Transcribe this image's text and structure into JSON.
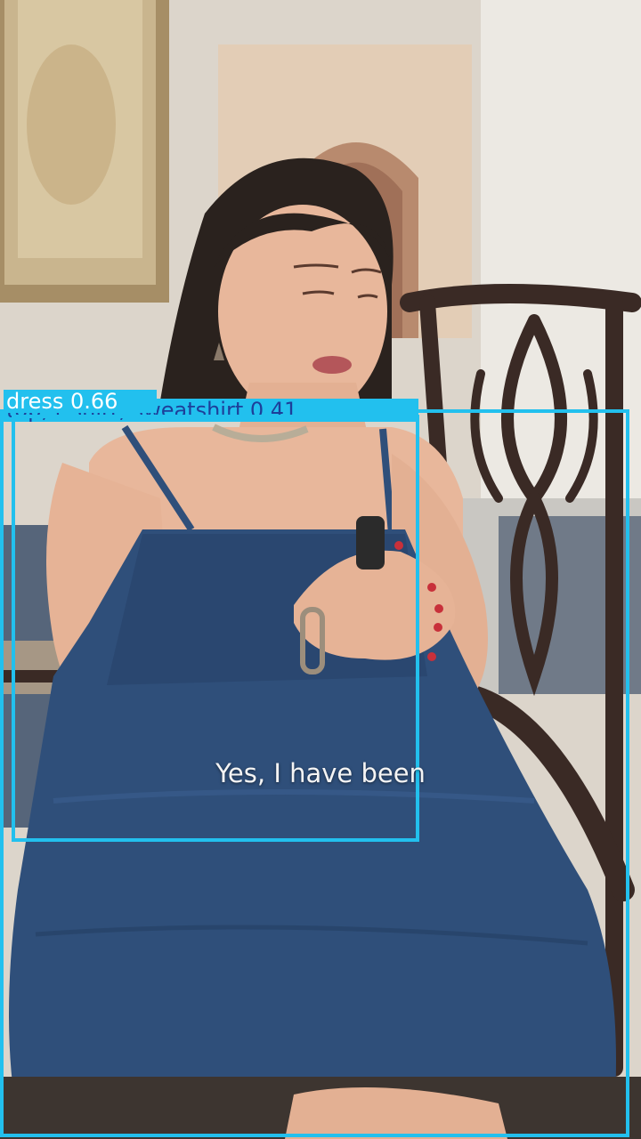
{
  "photo": {
    "description_icon": "woman-seated-photo",
    "colors": {
      "wall": "#d9d2c8",
      "dress": "#2f4f7a",
      "skin": "#e8b79b",
      "hair": "#2a221e",
      "chair": "#3a2a25",
      "frame": "#b39e7e"
    }
  },
  "detections": [
    {
      "label": "top, t-shirt, sweatshirt",
      "score": "0.41",
      "text": "top, t-shirt, sweatshirt  0.41",
      "box_color": "#22c0ee",
      "text_color": "#1d3f9a"
    },
    {
      "label": "dress",
      "score": "0.66",
      "text": "dress  0.66",
      "box_color": "#22c0ee",
      "text_color": "#ffffff"
    }
  ],
  "caption": {
    "text": "Yes, I have been"
  }
}
